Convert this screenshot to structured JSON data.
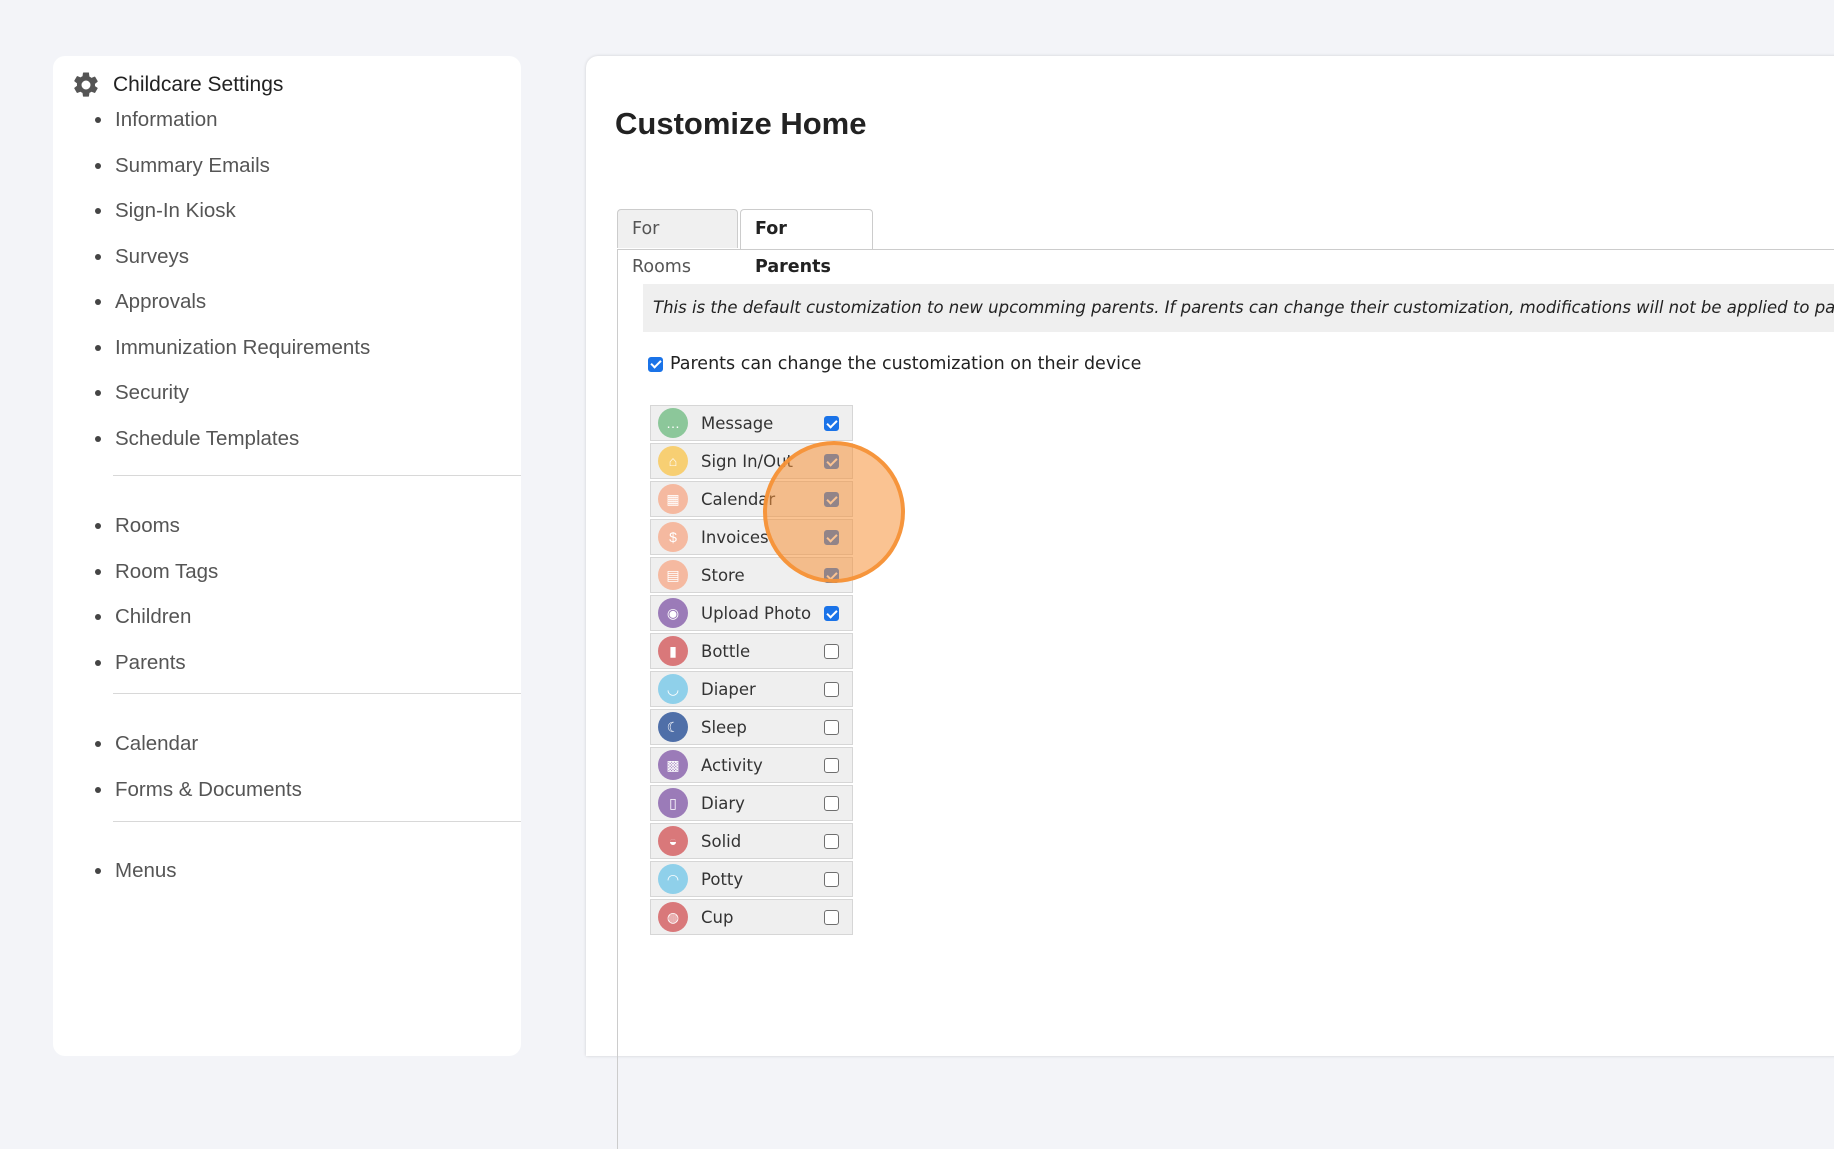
{
  "sidebar": {
    "title": "Childcare Settings",
    "group1": [
      "Information",
      "Summary Emails",
      "Sign-In Kiosk",
      "Surveys",
      "Approvals",
      "Immunization Requirements",
      "Security",
      "Schedule Templates"
    ],
    "group2": [
      "Rooms",
      "Room Tags",
      "Children",
      "Parents"
    ],
    "group3": [
      "Calendar",
      "Forms & Documents"
    ],
    "group4": [
      "Menus"
    ]
  },
  "main": {
    "title": "Customize Home",
    "tabs": [
      {
        "label": "For Rooms",
        "active": false
      },
      {
        "label": "For Parents",
        "active": true
      }
    ],
    "notice": "This is the default customization to new upcomming parents. If parents can change their customization, modifications will not be applied to parents a",
    "allow_label": "Parents can change the customization on their device",
    "allow_checked": true,
    "features": [
      {
        "name": "Message",
        "icon": "message-icon",
        "color": "#8cc79a",
        "checked": true
      },
      {
        "name": "Sign In/Out",
        "icon": "home-icon",
        "color": "#f7cf73",
        "checked": true
      },
      {
        "name": "Calendar",
        "icon": "calendar-icon",
        "color": "#f5b9a0",
        "checked": true
      },
      {
        "name": "Invoices",
        "icon": "invoice-icon",
        "color": "#f5b9a0",
        "checked": true
      },
      {
        "name": "Store",
        "icon": "store-icon",
        "color": "#f5b9a0",
        "checked": true
      },
      {
        "name": "Upload Photo",
        "icon": "camera-icon",
        "color": "#9b7bb8",
        "checked": true
      },
      {
        "name": "Bottle",
        "icon": "bottle-icon",
        "color": "#d9787a",
        "checked": false
      },
      {
        "name": "Diaper",
        "icon": "diaper-icon",
        "color": "#8fd0ea",
        "checked": false
      },
      {
        "name": "Sleep",
        "icon": "moon-icon",
        "color": "#4f6fa8",
        "checked": false
      },
      {
        "name": "Activity",
        "icon": "blocks-icon",
        "color": "#9b7bb8",
        "checked": false
      },
      {
        "name": "Diary",
        "icon": "notebook-icon",
        "color": "#9b7bb8",
        "checked": false
      },
      {
        "name": "Solid",
        "icon": "bowl-icon",
        "color": "#d9787a",
        "checked": false
      },
      {
        "name": "Potty",
        "icon": "potty-icon",
        "color": "#8fd0ea",
        "checked": false
      },
      {
        "name": "Cup",
        "icon": "cup-icon",
        "color": "#d9787a",
        "checked": false
      }
    ]
  }
}
